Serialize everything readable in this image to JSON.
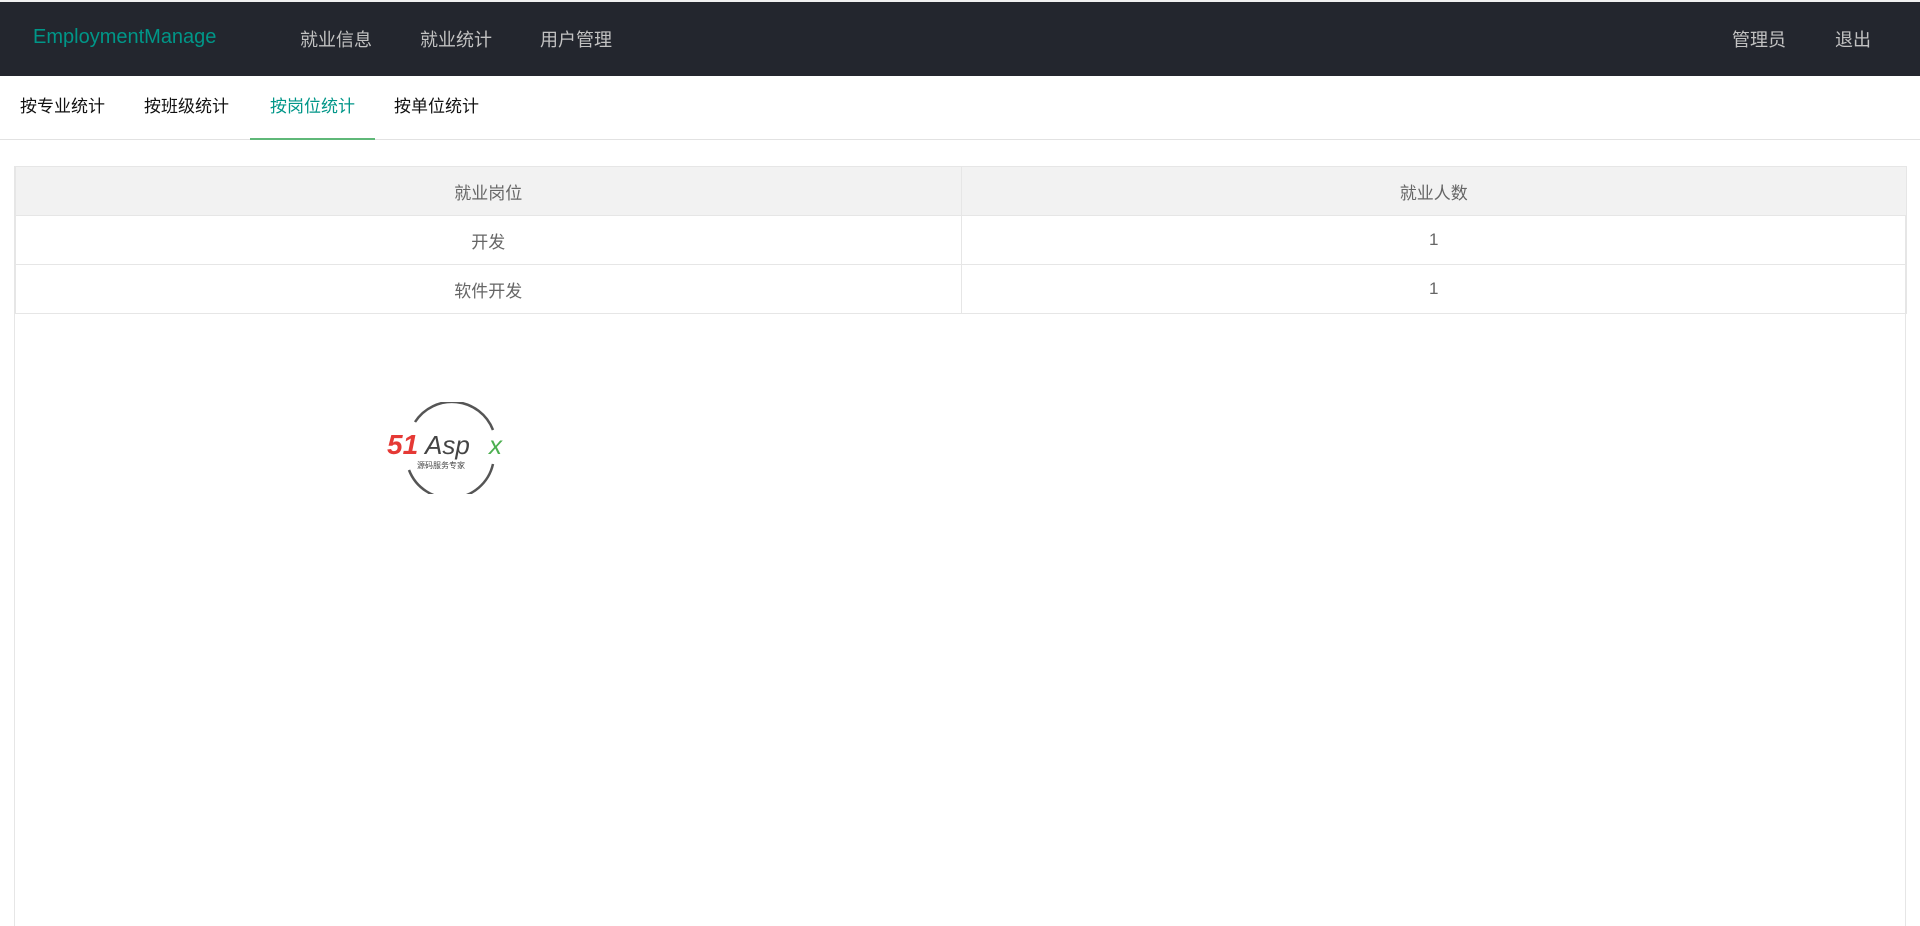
{
  "header": {
    "logo": "EmploymentManage",
    "nav": [
      "就业信息",
      "就业统计",
      "用户管理"
    ],
    "user": "管理员",
    "logout": "退出"
  },
  "tabs": [
    "按专业统计",
    "按班级统计",
    "按岗位统计",
    "按单位统计"
  ],
  "active_tab": "按岗位统计",
  "table": {
    "columns": [
      "就业岗位",
      "就业人数"
    ],
    "rows": [
      [
        "开发",
        "1"
      ],
      [
        "软件开发",
        "1"
      ]
    ]
  },
  "watermark": {
    "brand": "51Aspx",
    "tagline": "源码服务专家"
  },
  "colors": {
    "accent": "#009688",
    "header_bg": "#23262e",
    "tab_underline": "#5fb878"
  }
}
